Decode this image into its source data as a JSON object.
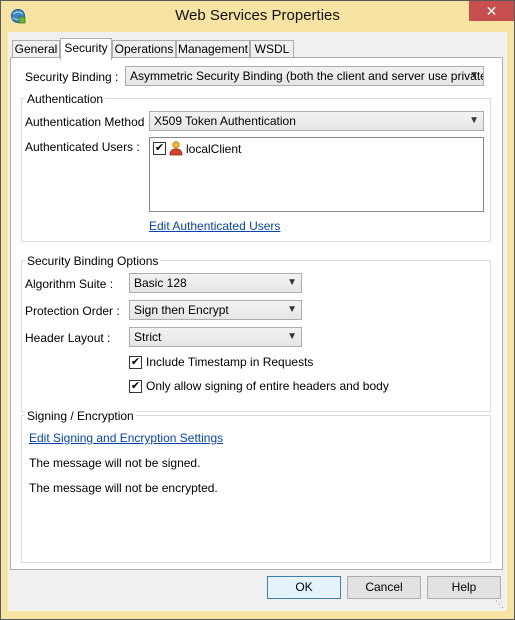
{
  "window": {
    "title": "Web Services Properties",
    "close_glyph": "✕"
  },
  "tabs": [
    "General",
    "Security",
    "Operations",
    "Management",
    "WSDL"
  ],
  "security_binding": {
    "label": "Security Binding :",
    "value": "Asymmetric Security Binding (both the client and server use private key"
  },
  "authentication": {
    "title": "Authentication",
    "method_label": "Authentication Method :",
    "method_value": "X509 Token Authentication",
    "users_label": "Authenticated Users :",
    "users": [
      {
        "name": "localClient",
        "checked": true
      }
    ],
    "edit_link": "Edit Authenticated Users"
  },
  "binding_options": {
    "title": "Security Binding Options",
    "algorithm_label": "Algorithm Suite :",
    "algorithm_value": "Basic 128",
    "protection_label": "Protection Order :",
    "protection_value": "Sign then Encrypt",
    "header_label": "Header Layout :",
    "header_value": "Strict",
    "include_timestamp": "Include Timestamp in Requests",
    "only_entire_headers": "Only allow signing of entire headers and body"
  },
  "signing": {
    "title": "Signing / Encryption",
    "edit_link": "Edit Signing and Encryption Settings",
    "not_signed": "The message will not be signed.",
    "not_encrypted": "The message will not be encrypted."
  },
  "buttons": {
    "ok": "OK",
    "cancel": "Cancel",
    "help": "Help"
  },
  "colors": {
    "title_bar": "#f7e4a2",
    "close": "#c7504f",
    "link": "#0645ad"
  },
  "icons": [
    "web-services-icon",
    "close-icon",
    "dropdown-arrow-icon",
    "user-icon",
    "checkmark-icon",
    "resize-grip-icon"
  ]
}
